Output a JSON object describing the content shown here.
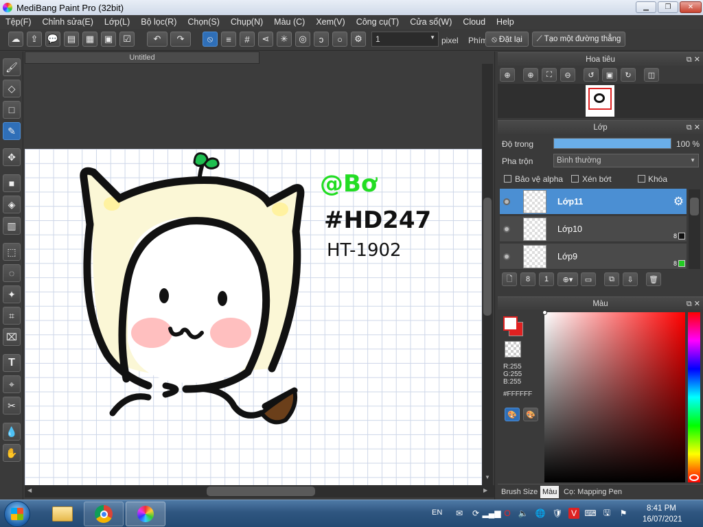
{
  "window": {
    "title": "MediBang Paint Pro (32bit)"
  },
  "menu": [
    "Tệp(F)",
    "Chỉnh sửa(E)",
    "Lớp(L)",
    "Bộ lọc(R)",
    "Chọn(S)",
    "Chụp(N)",
    "Màu (C)",
    "Xem(V)",
    "Công cụ(T)",
    "Cửa sổ(W)",
    "Cloud",
    "Help"
  ],
  "toolbar": {
    "brush_size_value": "1",
    "unit": "pixel",
    "hotkey_label": "Phím",
    "reset_label": "Đặt lại",
    "straight_line_label": "Tạo một đường thẳng"
  },
  "document": {
    "tab_title": "Untitled"
  },
  "drawing": {
    "handle": "@Bơ",
    "code1": "#HD247",
    "code2": "HT-1902"
  },
  "navigator": {
    "title": "Hoa tiêu"
  },
  "layers_panel": {
    "title": "Lớp",
    "opacity_label": "Độ trong",
    "opacity_value": "100 %",
    "opacity_fraction": 1.0,
    "blend_label": "Pha trộn",
    "blend_value": "Bình thường",
    "protect_alpha_label": "Bảo vệ alpha",
    "clipping_label": "Xén bớt",
    "lock_label": "Khóa",
    "layers": [
      {
        "name": "Lớp11",
        "selected": true
      },
      {
        "name": "Lớp10",
        "badge": "8",
        "badge_color": "#111111"
      },
      {
        "name": "Lớp9",
        "badge": "8",
        "badge_color": "#22cc22"
      }
    ]
  },
  "color_panel": {
    "title": "Màu",
    "r": "R:255",
    "g": "G:255",
    "b": "B:255",
    "hex": "#FFFFFF",
    "fg_color": "#ffffff",
    "bg_color": "#e02020"
  },
  "bottom_tabs": [
    "Brush Size",
    "Màu",
    "Cọ: Mapping Pen"
  ],
  "taskbar": {
    "lang": "EN",
    "time": "8:41 PM",
    "date": "16/07/2021"
  }
}
